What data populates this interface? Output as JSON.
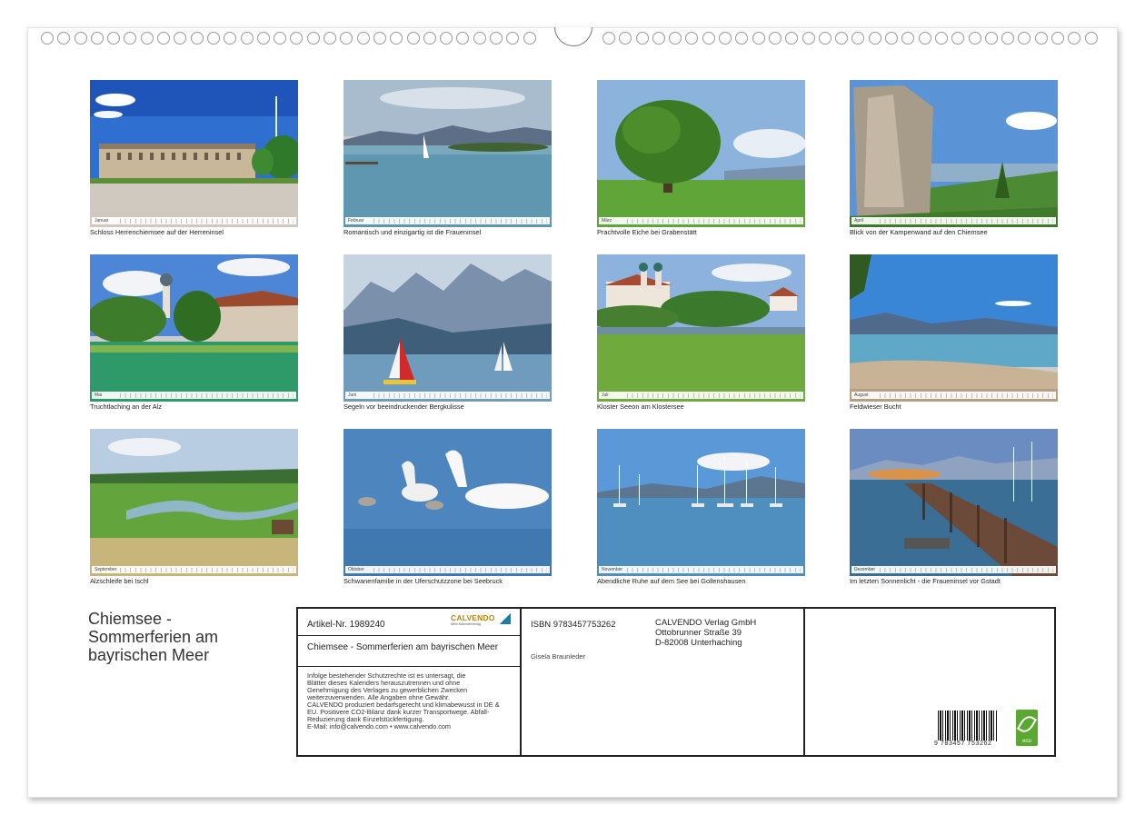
{
  "calendar": {
    "title_lines": [
      "Chiemsee -",
      "Sommerferien am",
      "bayrischen Meer"
    ],
    "photos": [
      {
        "month_label": "Januar",
        "caption": "Schloss Herrenchiemsee auf der Herreninsel"
      },
      {
        "month_label": "Februar",
        "caption": "Romantisch und einzigartig ist die Fraueninsel"
      },
      {
        "month_label": "März",
        "caption": "Prachtvolle Eiche bei Grabenstätt"
      },
      {
        "month_label": "April",
        "caption": "Blick von der Kampenwand auf den Chiemsee"
      },
      {
        "month_label": "Mai",
        "caption": "Truchtlaching an der Alz"
      },
      {
        "month_label": "Juni",
        "caption": "Segeln vor beeindruckender Bergkulisse"
      },
      {
        "month_label": "Juli",
        "caption": "Kloster Seeon am Klostersee"
      },
      {
        "month_label": "August",
        "caption": "Feldwieser Bucht"
      },
      {
        "month_label": "September",
        "caption": "Alzschleife bei Ischl"
      },
      {
        "month_label": "Oktober",
        "caption": "Schwanenfamilie in der Uferschutzzone bei Seebruck"
      },
      {
        "month_label": "November",
        "caption": "Abendliche Ruhe auf dem See bei Gollenshausen"
      },
      {
        "month_label": "Dezember",
        "caption": "Im letzten Sonnenlicht - die Fraueninsel vor Gstadt"
      }
    ]
  },
  "imprint": {
    "article_number": "Artikel-Nr. 1989240",
    "brand": "CALVENDO",
    "brand_tagline": "Mein Kalenderverlag",
    "title": "Chiemsee - Sommerferien am bayrischen Meer",
    "legal_lines": [
      "Infolge bestehender Schutzrechte ist es untersagt, die",
      "Blätter dieses Kalenders herauszutrennen und ohne",
      "Genehmigung des Verlages zu gewerblichen Zwecken",
      "weiterzuverwenden. Alle Angaben ohne Gewähr.",
      "CALVENDO produziert bedarfsgerecht und klimabewusst in DE &",
      "EU. Positivere CO2-Bilanz dank kurzer Transportwege. Abfall-",
      "Reduzierung dank Einzelstückfertigung.",
      "E-Mail: info@calvendo.com • www.calvendo.com"
    ],
    "isbn": "ISBN 9783457753262",
    "publisher_lines": [
      "CALVENDO Verlag GmbH",
      "Ottobrunner Straße 39",
      "D-82008 Unterhaching"
    ],
    "author": "Gisela Braunleder",
    "barcode_number": "9 783457 753262",
    "eco_label": "eco"
  },
  "colors": {
    "frame": "#222222",
    "eco_green": "#5aa832",
    "brand_gold": "#b8860b"
  }
}
